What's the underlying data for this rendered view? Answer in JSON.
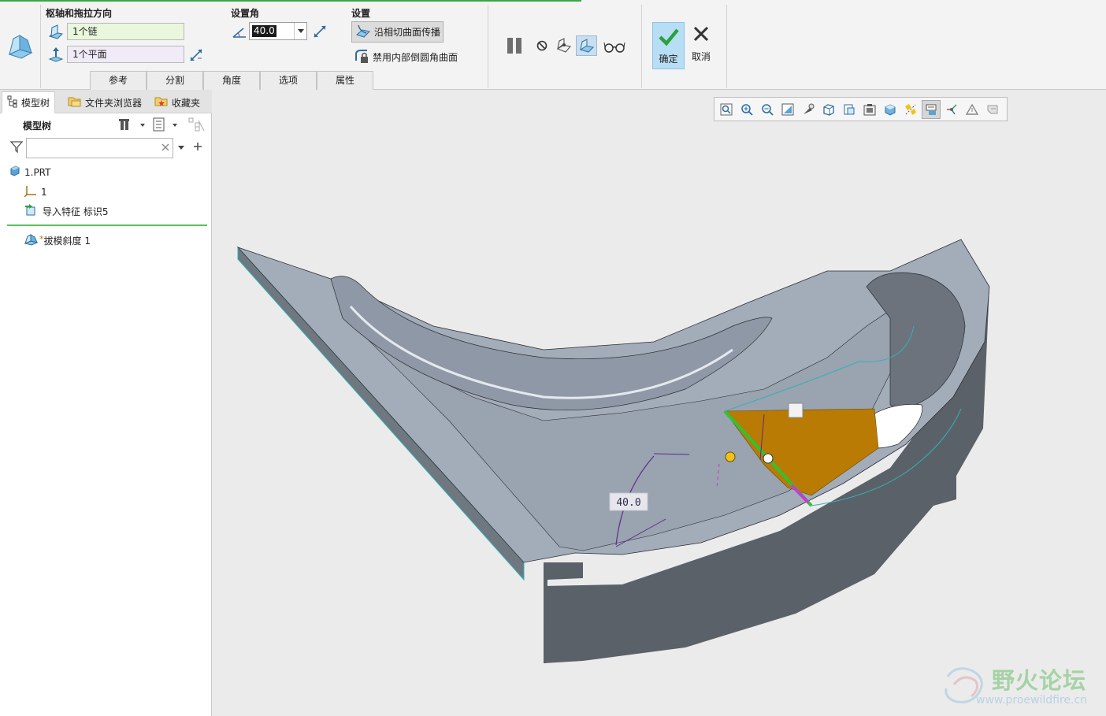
{
  "ribbon": {
    "pivot_group_title": "枢轴和拖拉方向",
    "pivot_chain_value": "1个链",
    "pull_plane_value": "1个平面",
    "angle_group_title": "设置角",
    "angle_value": "40.0",
    "settings_group_title": "设置",
    "propagate_label": "沿相切曲面传播",
    "exclude_round_label": "禁用内部倒圆角曲面",
    "tabs": [
      {
        "label": "参考"
      },
      {
        "label": "分割"
      },
      {
        "label": "角度"
      },
      {
        "label": "选项"
      },
      {
        "label": "属性"
      }
    ],
    "ok_label": "确定",
    "cancel_label": "取消"
  },
  "left_panel": {
    "tabs": [
      {
        "label": "模型树"
      },
      {
        "label": "文件夹浏览器"
      },
      {
        "label": "收藏夹"
      }
    ],
    "tree_header": "模型树",
    "filter_placeholder": "",
    "tree_items": [
      {
        "label": "1.PRT",
        "icon": "part-icon"
      },
      {
        "label": "1",
        "icon": "csys-icon"
      },
      {
        "label": "导入特征 标识5",
        "icon": "import-feature-icon"
      },
      {
        "label": "拔模斜度 1",
        "icon": "draft-feature-icon",
        "prefix": "*"
      }
    ]
  },
  "viewport": {
    "angle_dimension": "40.0",
    "toolbar_icons": [
      "refit-icon",
      "zoom-in-icon",
      "zoom-out-icon",
      "repaint-icon",
      "perspective-icon",
      "display-style-icon",
      "saved-views-icon",
      "view-manager-icon",
      "appearance-icon",
      "datum-display-icon",
      "annotation-display-icon",
      "spin-center-icon",
      "axis-display-icon",
      "csys-display-icon"
    ]
  },
  "watermark": {
    "title": "野火论坛",
    "url": "www.proewildfire.cn"
  },
  "colors": {
    "accent_green": "#39a749",
    "pivot_field_bg": "#e9f7dd",
    "plane_field_bg": "#f1ebf7",
    "ok_button_bg": "#b8def5",
    "model_top": "#a3acb9",
    "model_side": "#5b6169",
    "draft_surface": "#b97b04",
    "pivot_edge": "#33c033"
  }
}
